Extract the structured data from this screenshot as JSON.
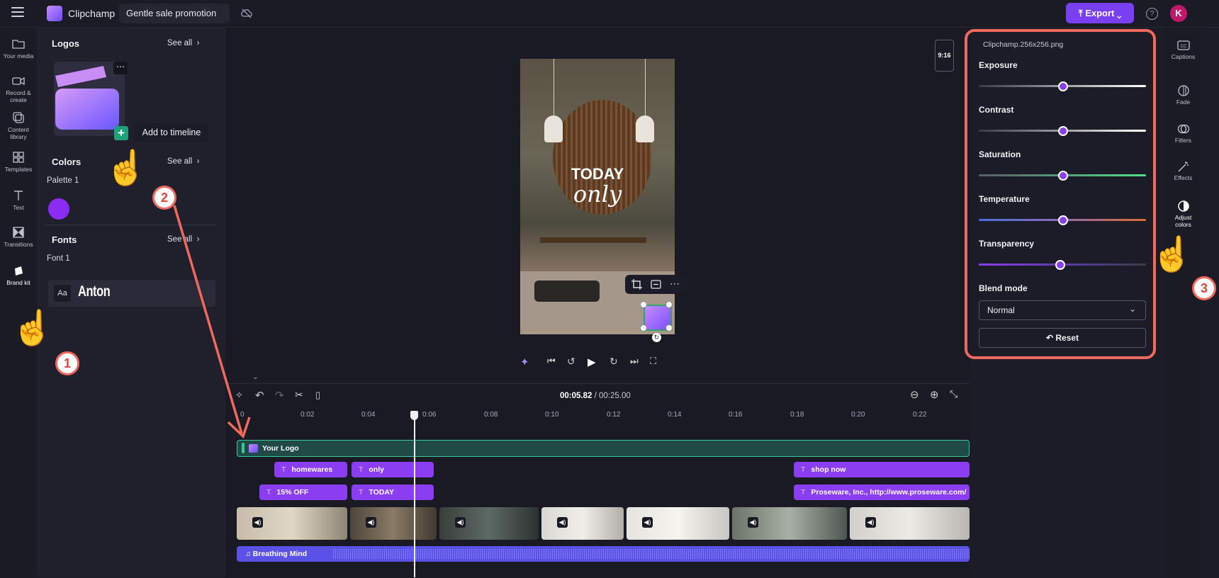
{
  "topbar": {
    "app_name": "Clipchamp",
    "project_title": "Gentle sale promotion",
    "export_label": "Export",
    "avatar_initial": "K",
    "help_glyph": "?"
  },
  "left_rail": [
    {
      "label": "Your media",
      "icon": "folder-icon"
    },
    {
      "label": "Record & create",
      "icon": "video-camera-icon"
    },
    {
      "label": "Content library",
      "icon": "library-icon"
    },
    {
      "label": "Templates",
      "icon": "templates-icon"
    },
    {
      "label": "Text",
      "icon": "text-icon"
    },
    {
      "label": "Transitions",
      "icon": "transitions-icon"
    },
    {
      "label": "Brand kit",
      "icon": "brand-kit-icon"
    }
  ],
  "brand_kit": {
    "logos_title": "Logos",
    "colors_title": "Colors",
    "fonts_title": "Fonts",
    "see_all": "See all",
    "add_to_timeline": "Add to timeline",
    "palette_label": "Palette 1",
    "palette_color": "#8b2cf5",
    "font_label": "Font 1",
    "font_aa": "Aa",
    "font_name": "Anton"
  },
  "preview": {
    "aspect_ratio": "9:16",
    "overlay_line1": "TODAY",
    "overlay_line2": "only"
  },
  "timeline": {
    "current_time": "00:05.82",
    "total_time": "/ 00:25.00",
    "ticks": [
      "0",
      "0:02",
      "0:04",
      "0:06",
      "0:08",
      "0:10",
      "0:12",
      "0:14",
      "0:16",
      "0:18",
      "0:20",
      "0:22"
    ],
    "logo_track_label": "Your Logo",
    "text_clips_row1": [
      "homewares",
      "only",
      "shop now"
    ],
    "text_clips_row2": [
      "15% OFF",
      "TODAY",
      "Proseware, Inc., http://www.proseware.com/"
    ],
    "audio_label": "Breathing Mind"
  },
  "adjust_colors": {
    "file_name": "Clipchamp.256x256.png",
    "sliders": [
      {
        "label": "Exposure",
        "value": 0.5
      },
      {
        "label": "Contrast",
        "value": 0.5
      },
      {
        "label": "Saturation",
        "value": 0.5
      },
      {
        "label": "Temperature",
        "value": 0.5
      },
      {
        "label": "Transparency",
        "value": 0.48
      }
    ],
    "blend_label": "Blend mode",
    "blend_value": "Normal",
    "reset_label": "Reset"
  },
  "right_rail": [
    {
      "label": "Captions",
      "icon": "captions-icon"
    },
    {
      "label": "Fade",
      "icon": "fade-icon"
    },
    {
      "label": "Filters",
      "icon": "filters-icon"
    },
    {
      "label": "Effects",
      "icon": "effects-icon"
    },
    {
      "label": "Adjust colors",
      "icon": "adjust-colors-icon"
    }
  ],
  "annotations": [
    "1",
    "2",
    "3"
  ],
  "colors": {
    "accent": "#7a3ff2",
    "text_clip": "#8b3df2",
    "logo_track": "#3ac79a",
    "audio_track": "#5a52e6",
    "highlight": "#f0695e"
  }
}
